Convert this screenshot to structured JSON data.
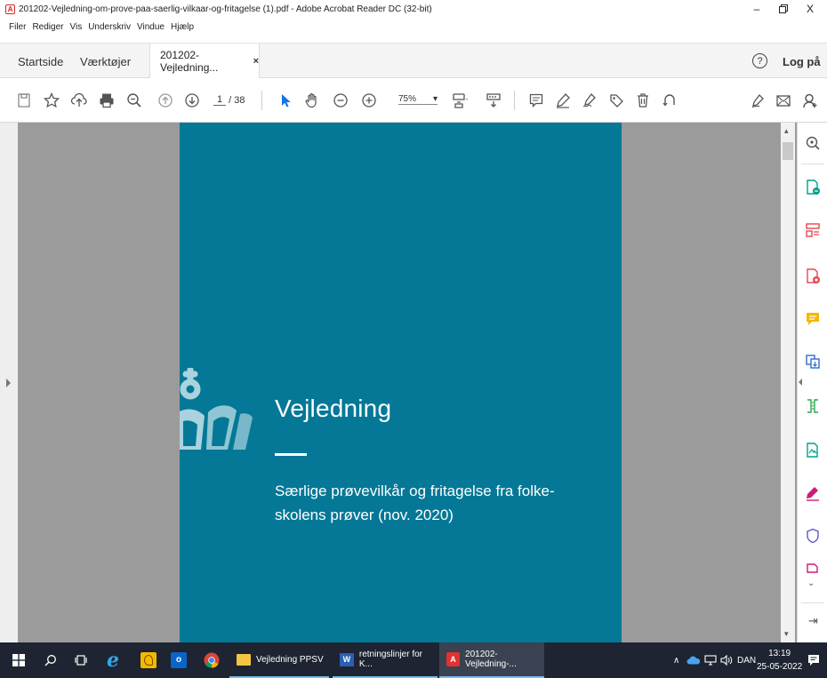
{
  "window": {
    "title": "201202-Vejledning-om-prove-paa-saerlig-vilkaar-og-fritagelse (1).pdf - Adobe Acrobat Reader DC (32-bit)",
    "minimize": "–",
    "maximize": "ð",
    "close": "X"
  },
  "menu": {
    "items": [
      "Filer",
      "Rediger",
      "Vis",
      "Underskriv",
      "Vindue",
      "Hjælp"
    ]
  },
  "tabs": {
    "home": "Startside",
    "tools": "Værktøjer",
    "document": "201202-Vejledning...",
    "close": "×",
    "help": "?",
    "login": "Log på"
  },
  "toolbar": {
    "page_current": "1",
    "page_total": "/ 38",
    "zoom": "75%",
    "zoom_arrow": "▾"
  },
  "document": {
    "title": "Vejledning",
    "subtitle": "Særlige prøvevilkår og fritagelse fra folke-skolens prøver (nov. 2020)",
    "background_color": "#047896"
  },
  "taskbar": {
    "apps": [
      {
        "label": "Vejledning PPSV"
      },
      {
        "label": "retningslinjer for K..."
      },
      {
        "label": "201202-Vejledning-..."
      }
    ],
    "language": "DAN",
    "time": "13:19",
    "date": "25-05-2022"
  },
  "colors": {
    "accent": "#047896",
    "taskbar": "#1e2431",
    "acrobat_red": "#d22222"
  }
}
